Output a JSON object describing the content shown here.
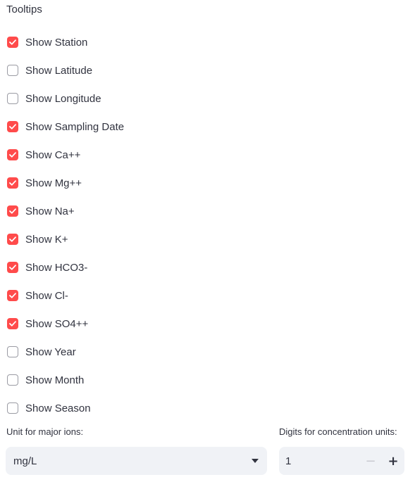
{
  "tooltips": {
    "title": "Tooltips",
    "options": [
      {
        "label": "Show Station",
        "checked": true
      },
      {
        "label": "Show Latitude",
        "checked": false
      },
      {
        "label": "Show Longitude",
        "checked": false
      },
      {
        "label": "Show Sampling Date",
        "checked": true
      },
      {
        "label": "Show Ca++",
        "checked": true
      },
      {
        "label": "Show Mg++",
        "checked": true
      },
      {
        "label": "Show Na+",
        "checked": true
      },
      {
        "label": "Show K+",
        "checked": true
      },
      {
        "label": "Show HCO3-",
        "checked": true
      },
      {
        "label": "Show Cl-",
        "checked": true
      },
      {
        "label": "Show SO4++",
        "checked": true
      },
      {
        "label": "Show Year",
        "checked": false
      },
      {
        "label": "Show Month",
        "checked": false
      },
      {
        "label": "Show Season",
        "checked": false
      }
    ]
  },
  "unit_select": {
    "label": "Unit for major ions:",
    "value": "mg/L",
    "icon": "chevron-down-icon"
  },
  "digits_input": {
    "label": "Digits for concentration units:",
    "value": "1",
    "minus_label": "−",
    "plus_label": "+"
  },
  "colors": {
    "accent": "#ff4b4b",
    "text": "#31333f",
    "input_bg": "#f0f2f6"
  }
}
